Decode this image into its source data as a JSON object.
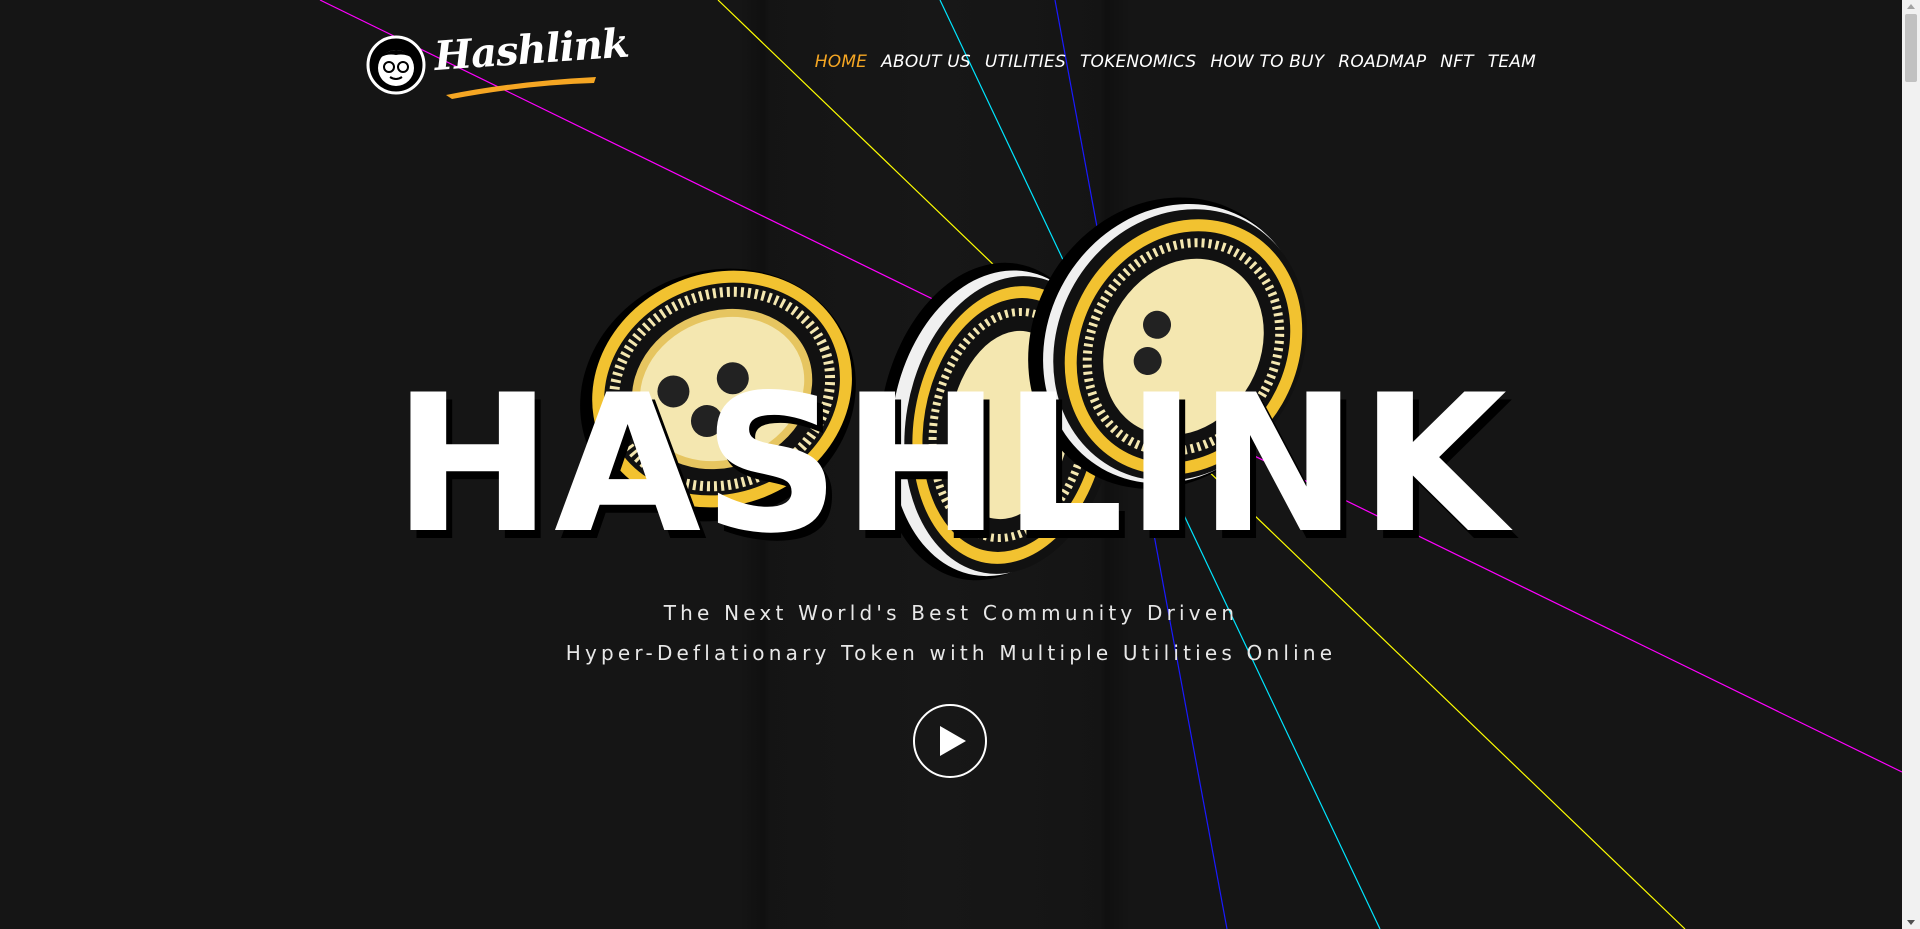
{
  "brand": {
    "name": "Hashlink",
    "accent_color": "#f5a623",
    "text_color": "#ffffff",
    "background_color": "#151515"
  },
  "nav": {
    "items": [
      {
        "label": "HOME",
        "active": true
      },
      {
        "label": "ABOUT US",
        "active": false
      },
      {
        "label": "UTILITIES",
        "active": false
      },
      {
        "label": "TOKENOMICS",
        "active": false
      },
      {
        "label": "HOW TO BUY",
        "active": false
      },
      {
        "label": "ROADMAP",
        "active": false
      },
      {
        "label": "NFT",
        "active": false
      },
      {
        "label": "TEAM",
        "active": false
      }
    ]
  },
  "hero": {
    "title": "HASHLINK",
    "subtitle_line1": "The Next World's Best Community Driven",
    "subtitle_line2": "Hyper-Deflationary Token with Multiple Utilities Online",
    "play_icon": "play-icon"
  },
  "decor": {
    "laser_colors": [
      "#ff00ff",
      "#ffff00",
      "#00e5ff",
      "#1a1aff"
    ],
    "coin_colors": {
      "gold": "#f2c230",
      "dark": "#111111",
      "light": "#f4e7b0"
    }
  }
}
